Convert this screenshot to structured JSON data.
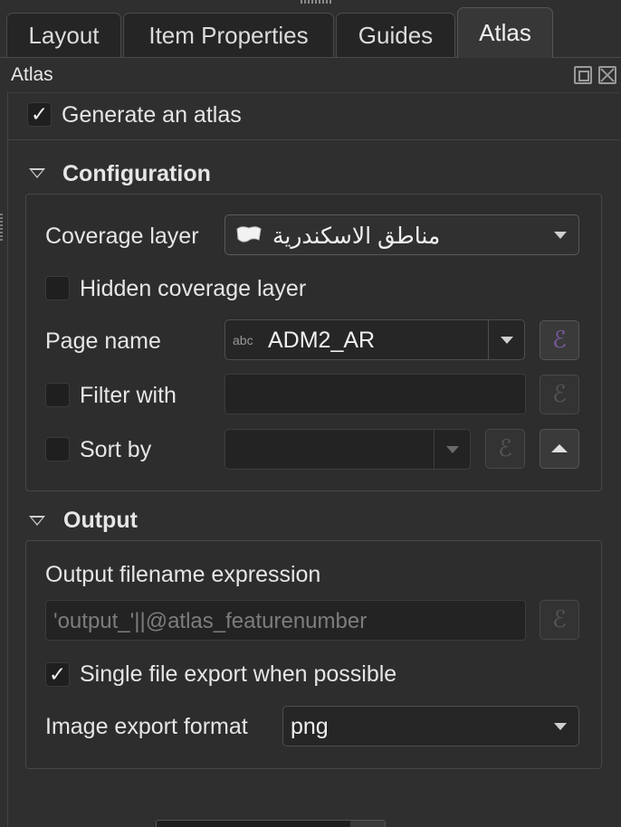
{
  "tabs": [
    {
      "label": "Layout",
      "active": false
    },
    {
      "label": "Item Properties",
      "active": false
    },
    {
      "label": "Guides",
      "active": false
    },
    {
      "label": "Atlas",
      "active": true
    }
  ],
  "panel": {
    "title": "Atlas"
  },
  "generate_atlas": {
    "label": "Generate an atlas",
    "checked": true,
    "check_glyph": "✓"
  },
  "configuration": {
    "title": "Configuration",
    "coverage_layer": {
      "label": "Coverage layer",
      "value": "مناطق الاسكندرية",
      "icon": "polygon-layer-icon"
    },
    "hidden_coverage": {
      "label": "Hidden coverage layer",
      "checked": false
    },
    "page_name": {
      "label": "Page name",
      "type_badge": "abc",
      "value": "ADM2_AR"
    },
    "filter_with": {
      "label": "Filter with",
      "checked": false,
      "value": ""
    },
    "sort_by": {
      "label": "Sort by",
      "checked": false,
      "value": ""
    },
    "expression_glyph": "ℰ"
  },
  "output": {
    "title": "Output",
    "filename_label": "Output filename expression",
    "filename_value": "'output_'||@atlas_featurenumber",
    "single_file": {
      "label": "Single file export when possible",
      "checked": true,
      "check_glyph": "✓"
    },
    "image_format": {
      "label": "Image export format",
      "value": "png"
    }
  }
}
